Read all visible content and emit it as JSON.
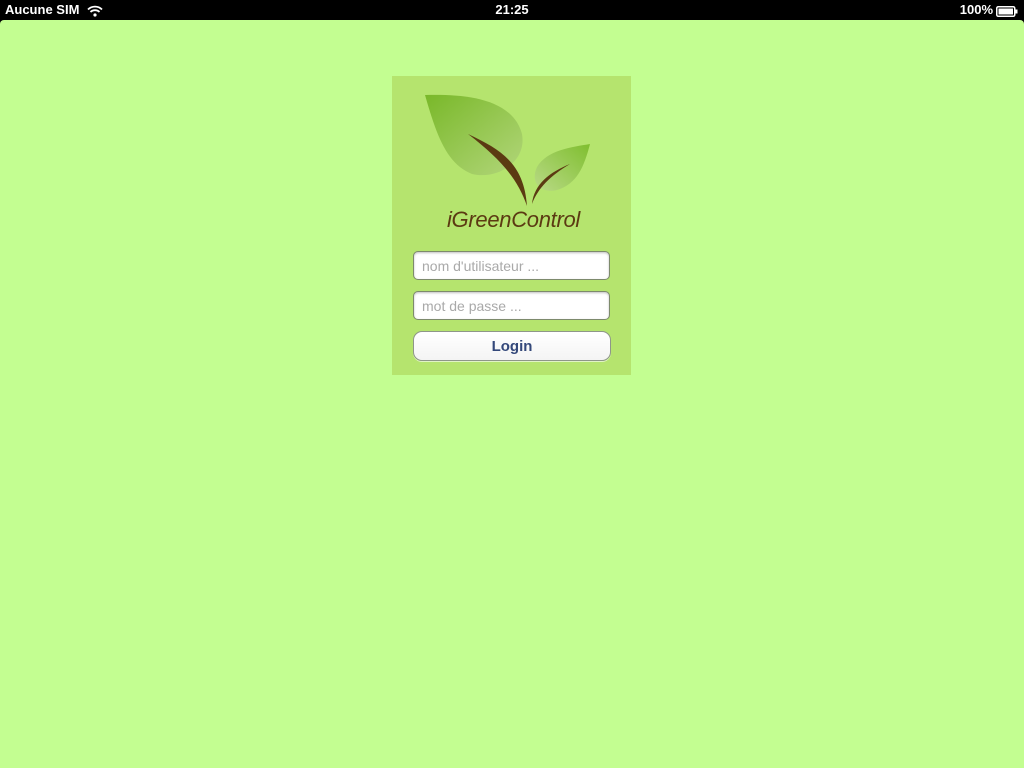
{
  "status_bar": {
    "carrier": "Aucune SIM",
    "time": "21:25",
    "battery": "100%",
    "icons": [
      "wifi-icon",
      "battery-icon"
    ]
  },
  "app": {
    "title": "iGreenControl",
    "logo_icon": "leaf-sprout-icon"
  },
  "login": {
    "username_placeholder": "nom d'utilisateur ...",
    "username_value": "",
    "password_placeholder": "mot de passe ...",
    "password_value": "",
    "button_label": "Login"
  },
  "colors": {
    "screen_background": "#c3fe91",
    "card_background": "#b5e46e",
    "title_color": "#5b3a12",
    "button_text": "#34487a",
    "leaf_green": "#8cc63f",
    "stem_brown": "#5b3a12"
  }
}
